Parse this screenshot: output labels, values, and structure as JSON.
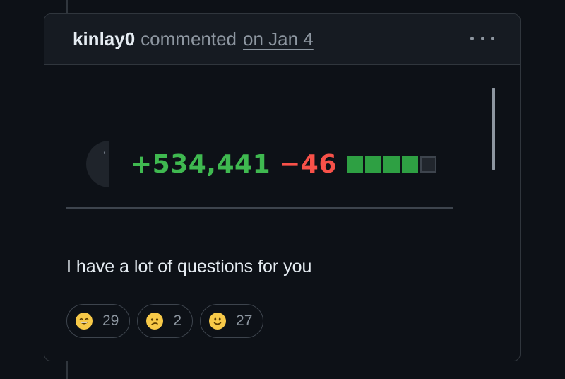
{
  "comment": {
    "author": "kinlay0",
    "action": "commented",
    "date": "on Jan 4",
    "menu_icon": "kebab-horizontal-icon"
  },
  "embed": {
    "additions": "+534,441",
    "deletions": "−46",
    "diff_blocks": [
      "add",
      "add",
      "add",
      "add",
      "neutral"
    ],
    "colors": {
      "additions": "#3fb950",
      "deletions": "#f85149",
      "block_add": "#2ea043",
      "block_neutral": "#21262d"
    }
  },
  "body": {
    "text": "I have a lot of questions for you"
  },
  "reactions": [
    {
      "emoji": "smile-emoji-icon",
      "count": "29"
    },
    {
      "emoji": "confused-emoji-icon",
      "count": "2"
    },
    {
      "emoji": "slight-smile-emoji-icon",
      "count": "27"
    }
  ]
}
